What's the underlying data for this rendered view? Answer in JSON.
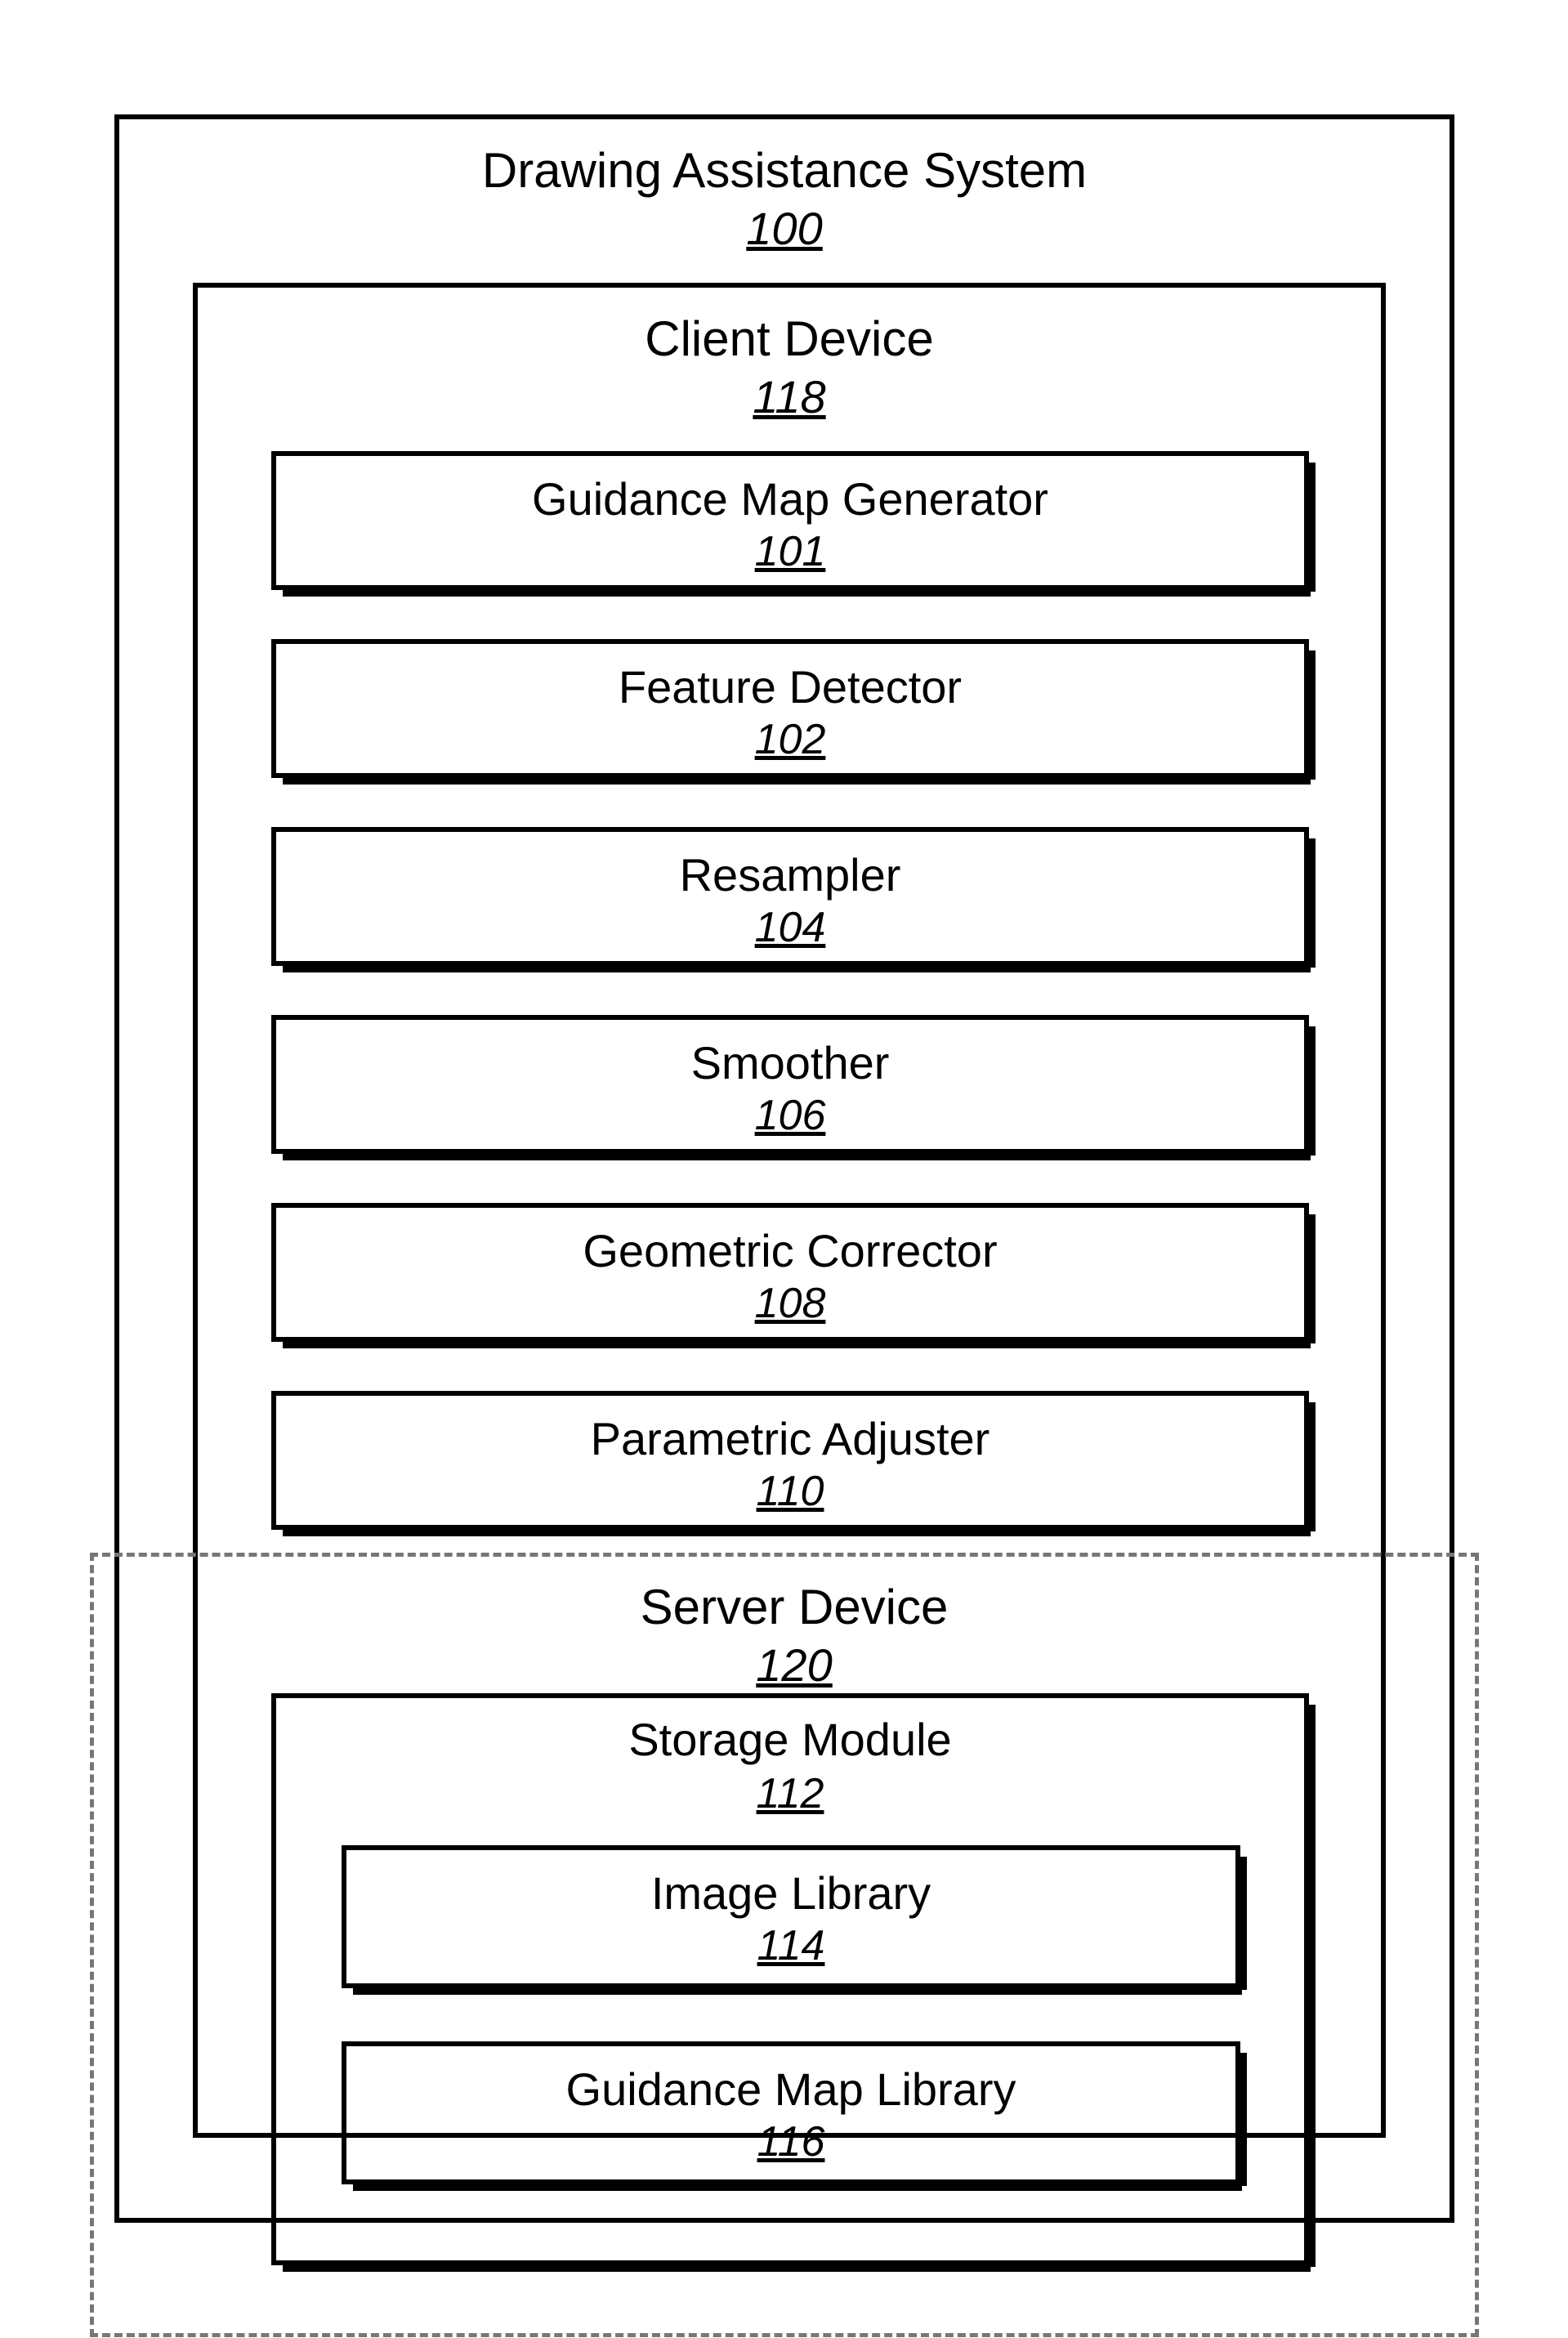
{
  "system": {
    "title": "Drawing Assistance System",
    "ref": "100"
  },
  "client": {
    "title": "Client Device",
    "ref": "118"
  },
  "modules": {
    "guidance_map_generator": {
      "title": "Guidance Map Generator",
      "ref": "101"
    },
    "feature_detector": {
      "title": "Feature Detector",
      "ref": "102"
    },
    "resampler": {
      "title": "Resampler",
      "ref": "104"
    },
    "smoother": {
      "title": "Smoother",
      "ref": "106"
    },
    "geometric_corrector": {
      "title": "Geometric Corrector",
      "ref": "108"
    },
    "parametric_adjuster": {
      "title": "Parametric Adjuster",
      "ref": "110"
    }
  },
  "server": {
    "title": "Server Device",
    "ref": "120"
  },
  "storage": {
    "title": "Storage Module",
    "ref": "112"
  },
  "libraries": {
    "image_library": {
      "title": "Image Library",
      "ref": "114"
    },
    "guidance_map_library": {
      "title": "Guidance Map Library",
      "ref": "116"
    }
  }
}
